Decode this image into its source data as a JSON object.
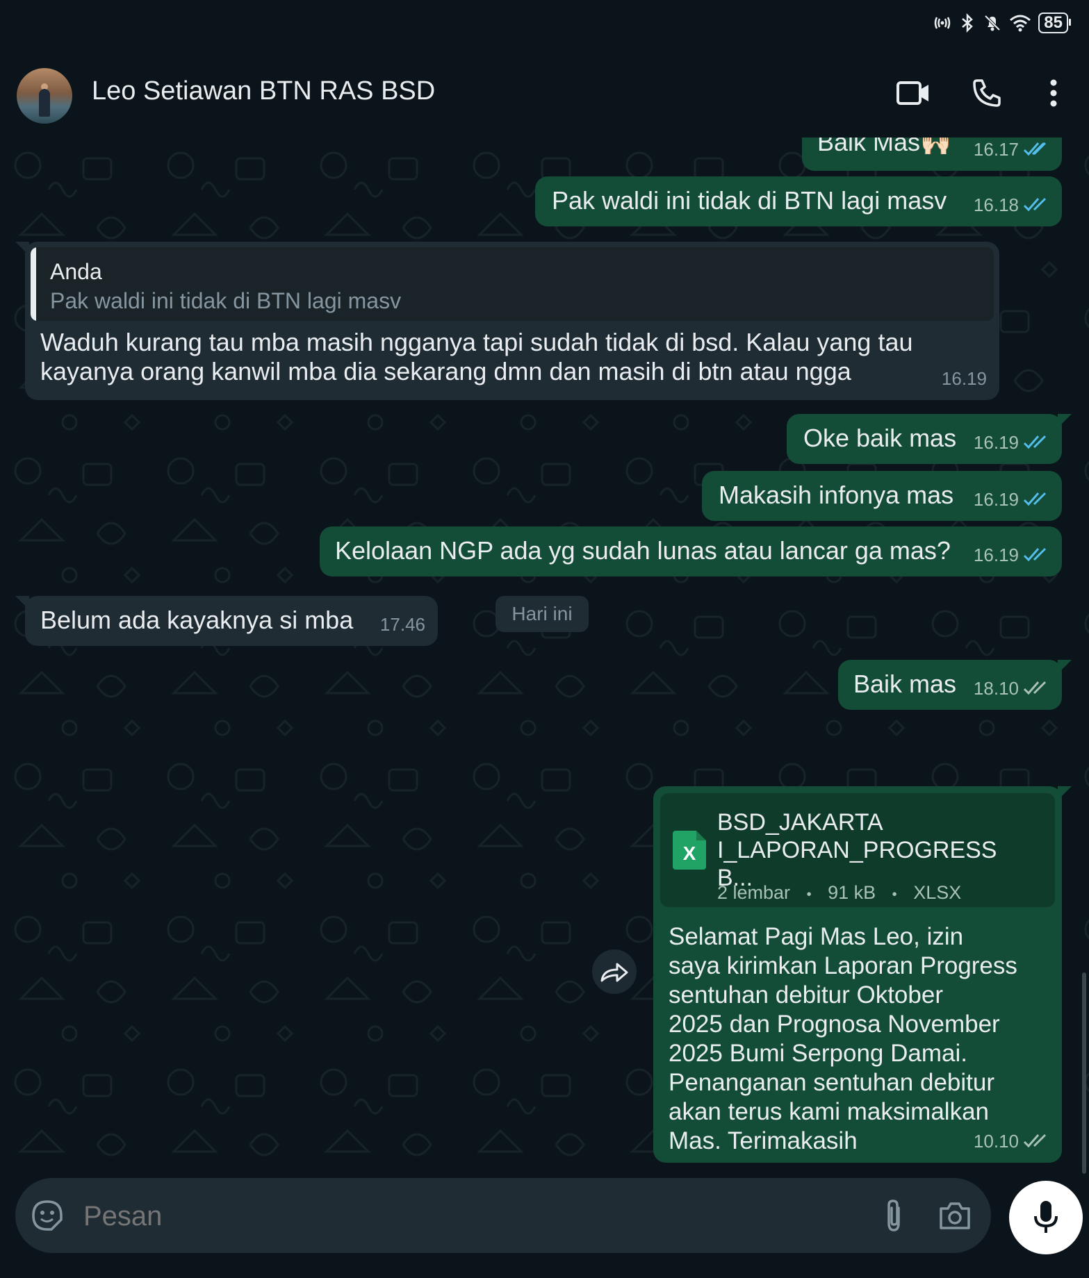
{
  "status_bar": {
    "battery": "85"
  },
  "header": {
    "contact_name": "Leo Setiawan BTN RAS BSD"
  },
  "messages": [
    {
      "dir": "out",
      "text": "Baik Mas🙌🏻",
      "time": "16.17",
      "read": true
    },
    {
      "dir": "out",
      "text": "Pak waldi ini tidak di BTN lagi masv",
      "time": "16.18",
      "read": true
    },
    {
      "dir": "in",
      "quote_author": "Anda",
      "quote_text": "Pak waldi ini tidak di BTN lagi masv",
      "text_line1": "Waduh kurang tau mba masih ngganya tapi sudah tidak di bsd. Kalau yang tau",
      "text_line2": "kayanya orang kanwil mba dia sekarang dmn dan masih di btn atau ngga",
      "time": "16.19"
    },
    {
      "dir": "out",
      "text": "Oke baik mas",
      "time": "16.19",
      "read": true
    },
    {
      "dir": "out",
      "text": "Makasih infonya mas",
      "time": "16.19",
      "read": true
    },
    {
      "dir": "out",
      "text": "Kelolaan NGP ada yg sudah lunas atau lancar ga mas?",
      "time": "16.19",
      "read": true
    },
    {
      "dir": "in",
      "text": "Belum ada kayaknya si mba",
      "time": "17.46"
    },
    {
      "dir": "out",
      "text": "Baik mas",
      "time": "18.10",
      "read": false
    }
  ],
  "date_divider": "Hari ini",
  "document_message": {
    "file_name_line1": "BSD_JAKARTA",
    "file_name_line2": "I_LAPORAN_PROGRESS B...",
    "pages": "2 lembar",
    "size": "91 kB",
    "type": "XLSX",
    "sep": "•",
    "icon_letter": "X",
    "caption_lines": [
      "Selamat Pagi Mas Leo, izin",
      "saya kirimkan Laporan Progress",
      "sentuhan debitur Oktober",
      "2025 dan Prognosa November",
      "2025 Bumi Serpong Damai.",
      "Penanganan sentuhan debitur",
      "akan terus kami maksimalkan",
      "Mas. Terimakasih"
    ],
    "time": "10.10",
    "read": false
  },
  "input": {
    "placeholder": "Pesan"
  },
  "icons": {
    "video": "video-call-icon",
    "call": "phone-icon",
    "menu": "more-vert-icon",
    "emoji": "sticker-icon",
    "attach": "paperclip-icon",
    "camera": "camera-icon",
    "mic": "mic-icon",
    "forward": "forward-icon",
    "read": "double-check-icon"
  },
  "colors": {
    "outgoing_bubble": "#144d37",
    "incoming_bubble": "#1f2c34",
    "read_tick": "#53bdeb",
    "background": "#0b141a"
  }
}
